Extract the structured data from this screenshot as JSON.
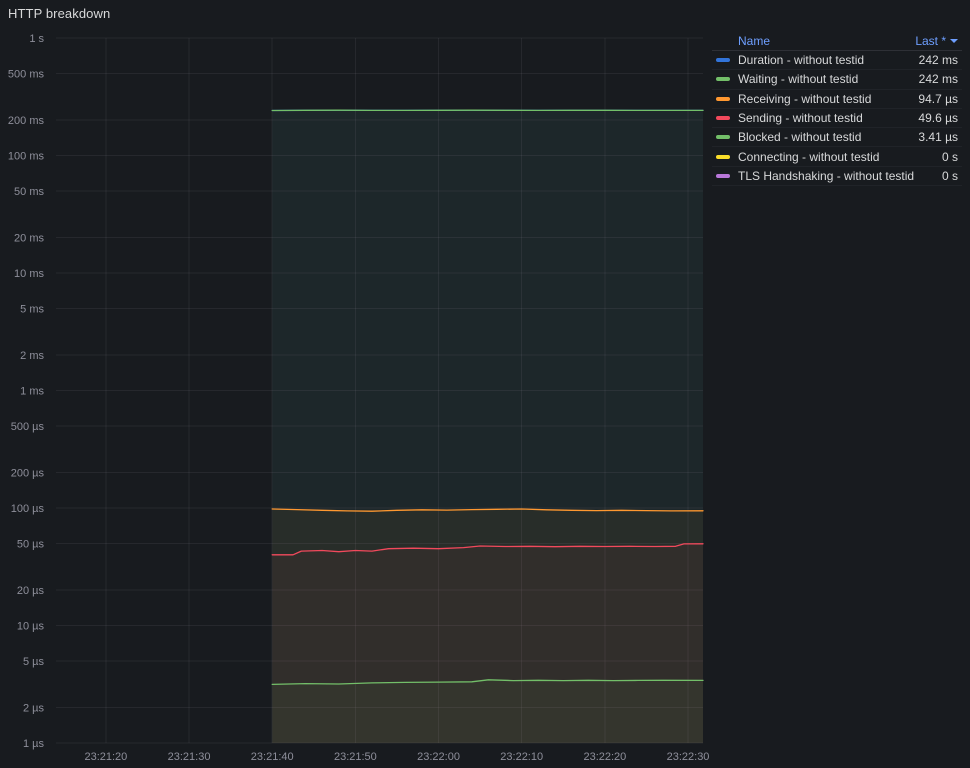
{
  "panel": {
    "title": "HTTP breakdown"
  },
  "legend": {
    "columns": {
      "name": "Name",
      "last": "Last *"
    },
    "rows": [
      {
        "label": "Duration - without testid",
        "value": "242 ms",
        "color": "#3274D9"
      },
      {
        "label": "Waiting - without testid",
        "value": "242 ms",
        "color": "#73BF69"
      },
      {
        "label": "Receiving - without testid",
        "value": "94.7 µs",
        "color": "#FF9830"
      },
      {
        "label": "Sending - without testid",
        "value": "49.6 µs",
        "color": "#F2495C"
      },
      {
        "label": "Blocked - without testid",
        "value": "3.41 µs",
        "color": "#73BF69"
      },
      {
        "label": "Connecting - without testid",
        "value": "0 s",
        "color": "#FADE2A"
      },
      {
        "label": "TLS Handshaking - without testid",
        "value": "0 s",
        "color": "#B877D9"
      }
    ]
  },
  "chart_data": {
    "type": "line",
    "title": "HTTP breakdown",
    "y_scale": "log",
    "y_unit": "seconds",
    "x_domain": [
      0,
      77.8
    ],
    "y_domain": [
      1e-06,
      1
    ],
    "grid": true,
    "legend_position": "right",
    "y_ticks": [
      {
        "v": 1,
        "label": "1 s"
      },
      {
        "v": 0.5,
        "label": "500 ms"
      },
      {
        "v": 0.2,
        "label": "200 ms"
      },
      {
        "v": 0.1,
        "label": "100 ms"
      },
      {
        "v": 0.05,
        "label": "50 ms"
      },
      {
        "v": 0.02,
        "label": "20 ms"
      },
      {
        "v": 0.01,
        "label": "10 ms"
      },
      {
        "v": 0.005,
        "label": "5 ms"
      },
      {
        "v": 0.002,
        "label": "2 ms"
      },
      {
        "v": 0.001,
        "label": "1 ms"
      },
      {
        "v": 0.0005,
        "label": "500 µs"
      },
      {
        "v": 0.0002,
        "label": "200 µs"
      },
      {
        "v": 0.0001,
        "label": "100 µs"
      },
      {
        "v": 5e-05,
        "label": "50 µs"
      },
      {
        "v": 2e-05,
        "label": "20 µs"
      },
      {
        "v": 1e-05,
        "label": "10 µs"
      },
      {
        "v": 5e-06,
        "label": "5 µs"
      },
      {
        "v": 2e-06,
        "label": "2 µs"
      },
      {
        "v": 1e-06,
        "label": "1 µs"
      }
    ],
    "x_ticks": [
      {
        "t": 6,
        "label": "23:21:20"
      },
      {
        "t": 16,
        "label": "23:21:30"
      },
      {
        "t": 26,
        "label": "23:21:40"
      },
      {
        "t": 36,
        "label": "23:21:50"
      },
      {
        "t": 46,
        "label": "23:22:00"
      },
      {
        "t": 56,
        "label": "23:22:10"
      },
      {
        "t": 66,
        "label": "23:22:20"
      },
      {
        "t": 76,
        "label": "23:22:30"
      }
    ],
    "series": [
      {
        "name": "Duration - without testid",
        "color": "#3274D9",
        "last": "242 ms",
        "points": [
          [
            26,
            0.2415
          ],
          [
            30,
            0.2425
          ],
          [
            34,
            0.2428
          ],
          [
            38,
            0.2422
          ],
          [
            42,
            0.2418
          ],
          [
            46,
            0.2425
          ],
          [
            50,
            0.243
          ],
          [
            54,
            0.2424
          ],
          [
            58,
            0.242
          ],
          [
            62,
            0.2424
          ],
          [
            66,
            0.2427
          ],
          [
            70,
            0.2422
          ],
          [
            74,
            0.242
          ],
          [
            77.8,
            0.242
          ]
        ]
      },
      {
        "name": "Waiting - without testid",
        "color": "#73BF69",
        "last": "242 ms",
        "points": [
          [
            26,
            0.2415
          ],
          [
            30,
            0.2425
          ],
          [
            34,
            0.2428
          ],
          [
            38,
            0.2422
          ],
          [
            42,
            0.2418
          ],
          [
            46,
            0.2425
          ],
          [
            50,
            0.243
          ],
          [
            54,
            0.2424
          ],
          [
            58,
            0.242
          ],
          [
            62,
            0.2424
          ],
          [
            66,
            0.2427
          ],
          [
            70,
            0.2422
          ],
          [
            74,
            0.242
          ],
          [
            77.8,
            0.242
          ]
        ]
      },
      {
        "name": "Receiving - without testid",
        "color": "#FF9830",
        "last": "94.7 µs",
        "points": [
          [
            26,
            9.8e-05
          ],
          [
            29,
            9.7e-05
          ],
          [
            32,
            9.55e-05
          ],
          [
            35,
            9.45e-05
          ],
          [
            38,
            9.4e-05
          ],
          [
            41,
            9.55e-05
          ],
          [
            44,
            9.65e-05
          ],
          [
            47,
            9.6e-05
          ],
          [
            50,
            9.7e-05
          ],
          [
            53,
            9.75e-05
          ],
          [
            56,
            9.8e-05
          ],
          [
            59,
            9.65e-05
          ],
          [
            62,
            9.55e-05
          ],
          [
            65,
            9.5e-05
          ],
          [
            68,
            9.55e-05
          ],
          [
            71,
            9.5e-05
          ],
          [
            74,
            9.45e-05
          ],
          [
            77.8,
            9.47e-05
          ]
        ]
      },
      {
        "name": "Sending - without testid",
        "color": "#F2495C",
        "last": "49.6 µs",
        "points": [
          [
            26,
            4e-05
          ],
          [
            28.5,
            4e-05
          ],
          [
            29.5,
            4.3e-05
          ],
          [
            32,
            4.35e-05
          ],
          [
            34,
            4.25e-05
          ],
          [
            36,
            4.35e-05
          ],
          [
            38,
            4.3e-05
          ],
          [
            40,
            4.5e-05
          ],
          [
            43,
            4.55e-05
          ],
          [
            46,
            4.5e-05
          ],
          [
            49,
            4.6e-05
          ],
          [
            51,
            4.75e-05
          ],
          [
            54,
            4.7e-05
          ],
          [
            57,
            4.72e-05
          ],
          [
            60,
            4.68e-05
          ],
          [
            63,
            4.72e-05
          ],
          [
            66,
            4.7e-05
          ],
          [
            69,
            4.72e-05
          ],
          [
            72,
            4.7e-05
          ],
          [
            74.5,
            4.72e-05
          ],
          [
            75.5,
            4.95e-05
          ],
          [
            77.8,
            4.96e-05
          ]
        ]
      },
      {
        "name": "Blocked - without testid",
        "color": "#73BF69",
        "last": "3.41 µs",
        "points": [
          [
            26,
            3.15e-06
          ],
          [
            30,
            3.2e-06
          ],
          [
            34,
            3.18e-06
          ],
          [
            38,
            3.25e-06
          ],
          [
            42,
            3.28e-06
          ],
          [
            46,
            3.3e-06
          ],
          [
            50,
            3.32e-06
          ],
          [
            52,
            3.45e-06
          ],
          [
            55,
            3.4e-06
          ],
          [
            58,
            3.42e-06
          ],
          [
            61,
            3.4e-06
          ],
          [
            64,
            3.42e-06
          ],
          [
            67,
            3.4e-06
          ],
          [
            70,
            3.41e-06
          ],
          [
            73,
            3.42e-06
          ],
          [
            77.8,
            3.41e-06
          ]
        ]
      },
      {
        "name": "Connecting - without testid",
        "color": "#FADE2A",
        "last": "0 s",
        "points": []
      },
      {
        "name": "TLS Handshaking - without testid",
        "color": "#B877D9",
        "last": "0 s",
        "points": []
      }
    ]
  }
}
